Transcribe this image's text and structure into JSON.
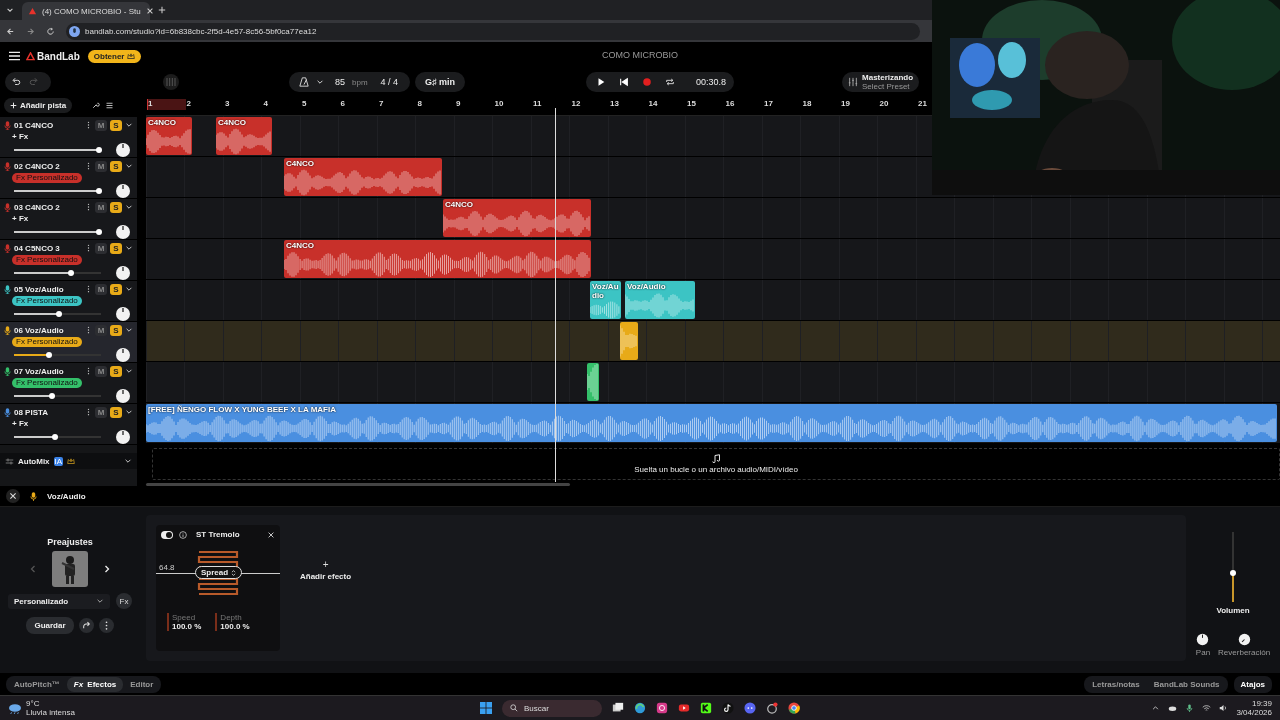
{
  "browser": {
    "tab_title": "(4) COMO MICROBIO - Stu",
    "url": "bandlab.com/studio?id=6b838cbc-2f5d-4e57-8c56-5bf0ca77ea12"
  },
  "app": {
    "logo": "BandLab",
    "upgrade": "Obtener",
    "project_title": "COMO MICROBIO"
  },
  "toolbar": {
    "bpm": "85",
    "bpm_unit": "bpm",
    "time_signature": "4 / 4",
    "key": "G♯ min",
    "time": "00:30.8",
    "mastering_title": "Masterizando",
    "mastering_preset": "Select Preset"
  },
  "add_track": "Añadir pista",
  "ruler": [
    "1",
    "2",
    "3",
    "4",
    "5",
    "6",
    "7",
    "8",
    "9",
    "10",
    "11",
    "12",
    "13",
    "14",
    "15",
    "16",
    "17",
    "18",
    "19",
    "20",
    "21"
  ],
  "tracks": [
    {
      "number": "01",
      "name": "C4NCO",
      "color": "#c8302a",
      "fx": {
        "kind": "add",
        "label": "+ Fx"
      },
      "level": 0.98,
      "mute": "M",
      "solo": "S",
      "soloed": true,
      "selected": false,
      "clips": [
        {
          "kind": "labeled",
          "label": "C4NCO"
        },
        {
          "kind": "labeled",
          "label": "C4NCO"
        }
      ]
    },
    {
      "number": "02",
      "name": "C4NCO 2",
      "color": "#c8302a",
      "fx": {
        "kind": "custom",
        "label": "Fx Personalizado"
      },
      "level": 0.98,
      "mute": "M",
      "solo": "S",
      "soloed": true,
      "selected": false,
      "clips": [
        {
          "kind": "labeled",
          "label": "C4NCO"
        }
      ]
    },
    {
      "number": "03",
      "name": "C4NCO 2",
      "color": "#c8302a",
      "fx": {
        "kind": "add",
        "label": "+ Fx"
      },
      "level": 0.98,
      "mute": "M",
      "solo": "S",
      "soloed": true,
      "selected": false,
      "clips": [
        {
          "kind": "labeled",
          "label": "C4NCO"
        }
      ]
    },
    {
      "number": "04",
      "name": "C5NCO 3",
      "color": "#c8302a",
      "fx": {
        "kind": "custom",
        "label": "Fx Personalizado"
      },
      "level": 0.66,
      "mute": "M",
      "solo": "S",
      "soloed": true,
      "selected": false,
      "clips": [
        {
          "kind": "labeled",
          "label": "C4NCO"
        }
      ]
    },
    {
      "number": "05",
      "name": "Voz/Audio",
      "color": "#3cc4c4",
      "fx": {
        "kind": "custom",
        "label": "Fx Personalizado"
      },
      "level": 0.52,
      "mute": "M",
      "solo": "S",
      "soloed": true,
      "selected": false,
      "clips": [
        {
          "kind": "labeled",
          "label": "Voz/Audio"
        },
        {
          "kind": "labeled",
          "label": "Voz/Audio"
        }
      ]
    },
    {
      "number": "06",
      "name": "Voz/Audio",
      "color": "#e8aa18",
      "fx": {
        "kind": "custom",
        "label": "Fx Personalizado"
      },
      "level": 0.4,
      "mute": "M",
      "solo": "S",
      "soloed": true,
      "selected": true,
      "clips": [
        {
          "kind": "plain"
        }
      ]
    },
    {
      "number": "07",
      "name": "Voz/Audio",
      "color": "#34c06a",
      "fx": {
        "kind": "custom",
        "label": "Fx Personalizado"
      },
      "level": 0.44,
      "mute": "M",
      "solo": "S",
      "soloed": true,
      "selected": false,
      "clips": [
        {
          "kind": "plain"
        }
      ]
    },
    {
      "number": "08",
      "name": "PISTA",
      "color": "#4a8fe0",
      "fx": {
        "kind": "add",
        "label": "+ Fx"
      },
      "level": 0.47,
      "mute": "M",
      "solo": "S",
      "soloed": true,
      "selected": false,
      "clips": [
        {
          "kind": "labeled",
          "label": "[FREE] ÑENGO FLOW X YUNG BEEF X LA MAFIA"
        }
      ]
    }
  ],
  "automix": {
    "label": "AutoMix",
    "badge": "IA"
  },
  "drop_zone": "Suelta un bucle o un archivo audio/MIDI/vídeo",
  "editor": {
    "track_name": "Voz/Audio",
    "presets_title": "Preajustes",
    "preset_name": "Personalizado",
    "fx_button": "Fx",
    "save": "Guardar",
    "effect": {
      "name": "ST Tremolo",
      "on": true,
      "value": "64.8",
      "mode": "Spread",
      "params": [
        {
          "name": "Speed",
          "value": "100.0 %"
        },
        {
          "name": "Depth",
          "value": "100.0 %"
        }
      ]
    },
    "add_effect_icon": "+",
    "add_effect": "Añadir efecto",
    "volume": {
      "label": "Volumen",
      "level": 0.41
    },
    "pan_label": "Pan",
    "reverb_label": "Reverberación"
  },
  "tabs": [
    {
      "label": "AutoPitch™",
      "selected": false
    },
    {
      "label": "Efectos",
      "prefix": "Fx",
      "selected": true
    },
    {
      "label": "Editor",
      "selected": false
    }
  ],
  "side_tabs": [
    "Letras/notas",
    "BandLab Sounds",
    "Atajos"
  ],
  "taskbar": {
    "temperature": "9°C",
    "weather": "Lluvia intensa",
    "search": "Buscar",
    "time": "19:39",
    "date": "3/04/2026"
  }
}
